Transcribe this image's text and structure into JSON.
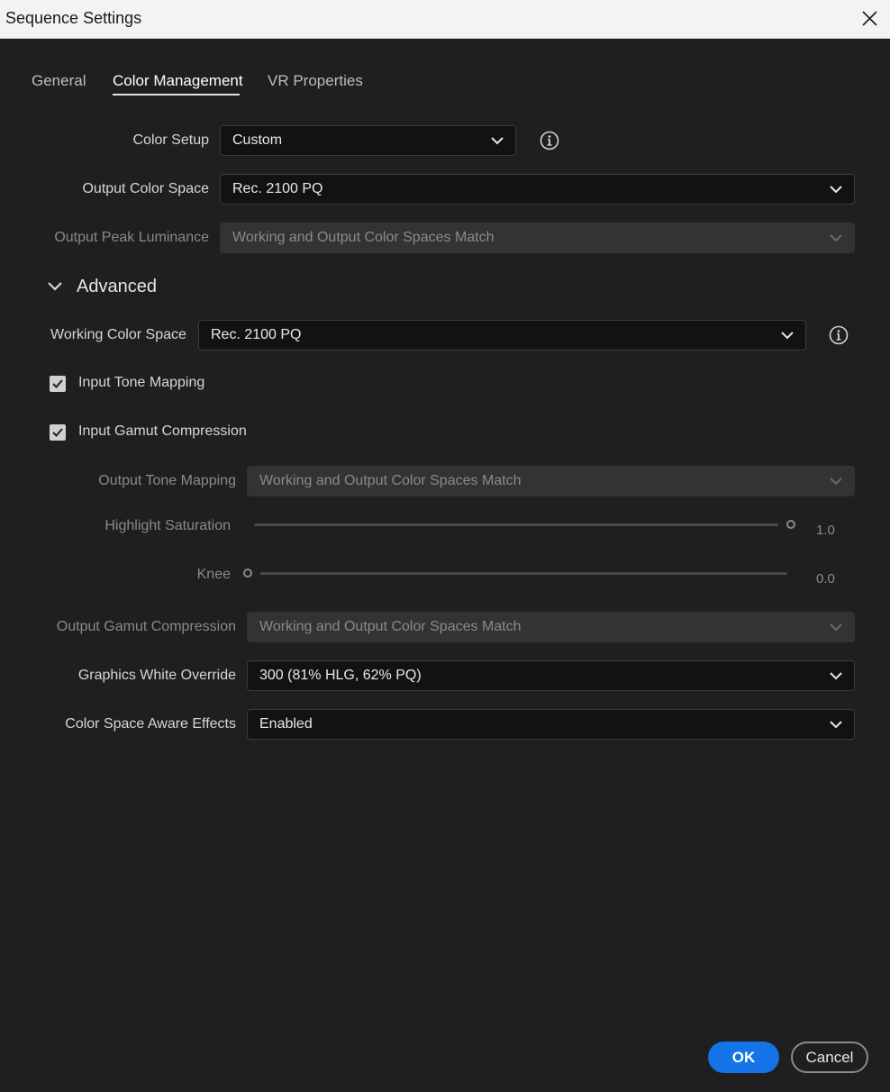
{
  "window": {
    "title": "Sequence Settings"
  },
  "tabs": [
    {
      "label": "General",
      "active": false
    },
    {
      "label": "Color Management",
      "active": true
    },
    {
      "label": "VR Properties",
      "active": false
    }
  ],
  "color_setup": {
    "label": "Color Setup",
    "value": "Custom"
  },
  "output_color_space": {
    "label": "Output Color Space",
    "value": "Rec. 2100 PQ"
  },
  "output_peak_luminance": {
    "label": "Output Peak Luminance",
    "value": "Working and Output Color Spaces Match",
    "disabled": true
  },
  "advanced": {
    "title": "Advanced",
    "expanded": true
  },
  "working_color_space": {
    "label": "Working Color Space",
    "value": "Rec. 2100 PQ"
  },
  "input_tone_mapping": {
    "label": "Input Tone Mapping",
    "checked": true
  },
  "input_gamut_compression": {
    "label": "Input Gamut Compression",
    "checked": true
  },
  "output_tone_mapping": {
    "label": "Output Tone Mapping",
    "value": "Working and Output Color Spaces Match",
    "disabled": true
  },
  "highlight_saturation": {
    "label": "Highlight Saturation",
    "value": "1.0",
    "level": 1.0
  },
  "knee": {
    "label": "Knee",
    "value": "0.0",
    "level": 0.0
  },
  "output_gamut_compression": {
    "label": "Output Gamut Compression",
    "value": "Working and Output Color Spaces Match",
    "disabled": true
  },
  "graphics_white_override": {
    "label": "Graphics White Override",
    "value": "300 (81% HLG, 62% PQ)"
  },
  "color_space_aware_effects": {
    "label": "Color Space Aware Effects",
    "value": "Enabled"
  },
  "buttons": {
    "ok": "OK",
    "cancel": "Cancel"
  },
  "colors": {
    "background": "#1f1f1f",
    "titlebar": "#f3f3f3",
    "accent": "#1473e6",
    "field": "#121212",
    "field_disabled": "#333333"
  },
  "icons": {
    "close": "close-icon",
    "info": "info-icon",
    "chevron": "chevron-down-icon",
    "check": "checkmark-icon"
  }
}
